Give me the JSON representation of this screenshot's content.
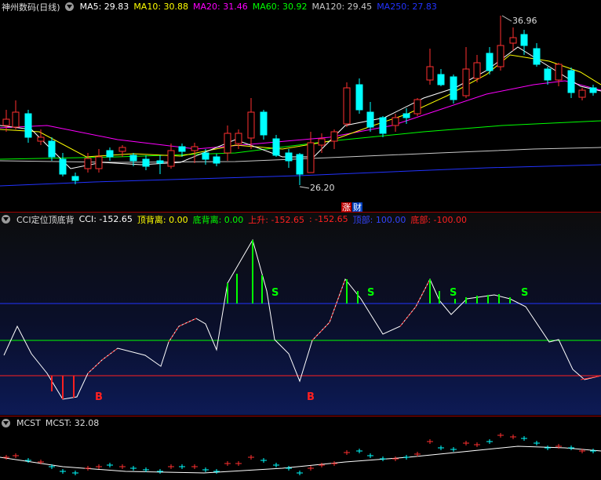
{
  "main": {
    "title": "神州数码(日线)",
    "ma": [
      {
        "label": "MA5: 29.83",
        "color": "#ffffff"
      },
      {
        "label": "MA10: 30.88",
        "color": "#ffff00"
      },
      {
        "label": "MA20: 31.46",
        "color": "#ff00ff"
      },
      {
        "label": "MA60: 30.92",
        "color": "#00ff00"
      },
      {
        "label": "MA120: 29.45",
        "color": "#c8c8c8"
      },
      {
        "label": "MA250: 27.83",
        "color": "#2233ff"
      }
    ],
    "high_label": "36.96",
    "low_label": "26.20",
    "badge_zhang": "涨",
    "badge_cai": "财"
  },
  "cci": {
    "title": "CCI定位顶底背",
    "items": [
      {
        "label": "CCI: -152.65",
        "color": "#ffffff"
      },
      {
        "label": "顶背离: 0.00",
        "color": "#ffff00"
      },
      {
        "label": "底背离: 0.00",
        "color": "#00ff00"
      },
      {
        "label": "上升: -152.65",
        "color": "#ff2020"
      },
      {
        "label": ": -152.65",
        "color": "#ff2020"
      },
      {
        "label": "顶部: 100.00",
        "color": "#3344ff"
      },
      {
        "label": "底部: -100.00",
        "color": "#ff2020"
      }
    ],
    "signals": {
      "buy": "B",
      "sell": "S"
    }
  },
  "mcst": {
    "title": "MCST",
    "value": "MCST: 32.08"
  },
  "colors": {
    "up": "#ff3030",
    "down": "#00ffff",
    "top_line": "#2233ff",
    "bottom_line": "#ff2020",
    "mid_line": "#00ff00"
  }
}
